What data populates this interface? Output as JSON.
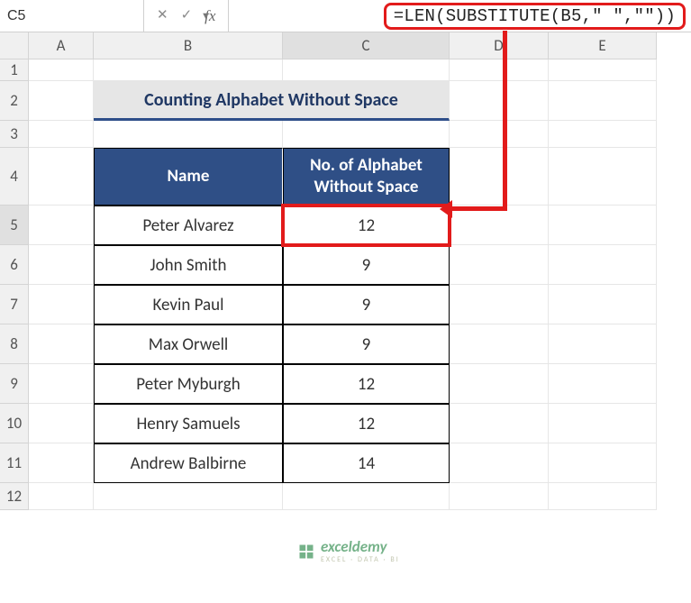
{
  "nameBox": "C5",
  "formula": "=LEN(SUBSTITUTE(B5,\" \",\"\"))",
  "columns": [
    "A",
    "B",
    "C",
    "D",
    "E"
  ],
  "rows": [
    "1",
    "2",
    "3",
    "4",
    "5",
    "6",
    "7",
    "8",
    "9",
    "10",
    "11",
    "12"
  ],
  "title": "Counting Alphabet Without Space",
  "headers": {
    "name": "Name",
    "count": "No. of Alphabet Without Space"
  },
  "data": [
    {
      "name": "Peter Alvarez",
      "count": "12"
    },
    {
      "name": "John Smith",
      "count": "9"
    },
    {
      "name": "Kevin Paul",
      "count": "9"
    },
    {
      "name": "Max Orwell",
      "count": "9"
    },
    {
      "name": "Peter Myburgh",
      "count": "12"
    },
    {
      "name": "Henry Samuels",
      "count": "12"
    },
    {
      "name": "Andrew Balbirne",
      "count": "14"
    }
  ],
  "icons": {
    "dropdown": "▼",
    "cancel": "✕",
    "confirm": "✓",
    "fx": "fx"
  },
  "watermark": {
    "main": "exceldemy",
    "sub": "EXCEL · DATA · BI"
  },
  "chart_data": {
    "type": "table",
    "title": "Counting Alphabet Without Space",
    "columns": [
      "Name",
      "No. of Alphabet Without Space"
    ],
    "rows": [
      [
        "Peter Alvarez",
        12
      ],
      [
        "John Smith",
        9
      ],
      [
        "Kevin Paul",
        9
      ],
      [
        "Max Orwell",
        9
      ],
      [
        "Peter Myburgh",
        12
      ],
      [
        "Henry Samuels",
        12
      ],
      [
        "Andrew Balbirne",
        14
      ]
    ]
  }
}
